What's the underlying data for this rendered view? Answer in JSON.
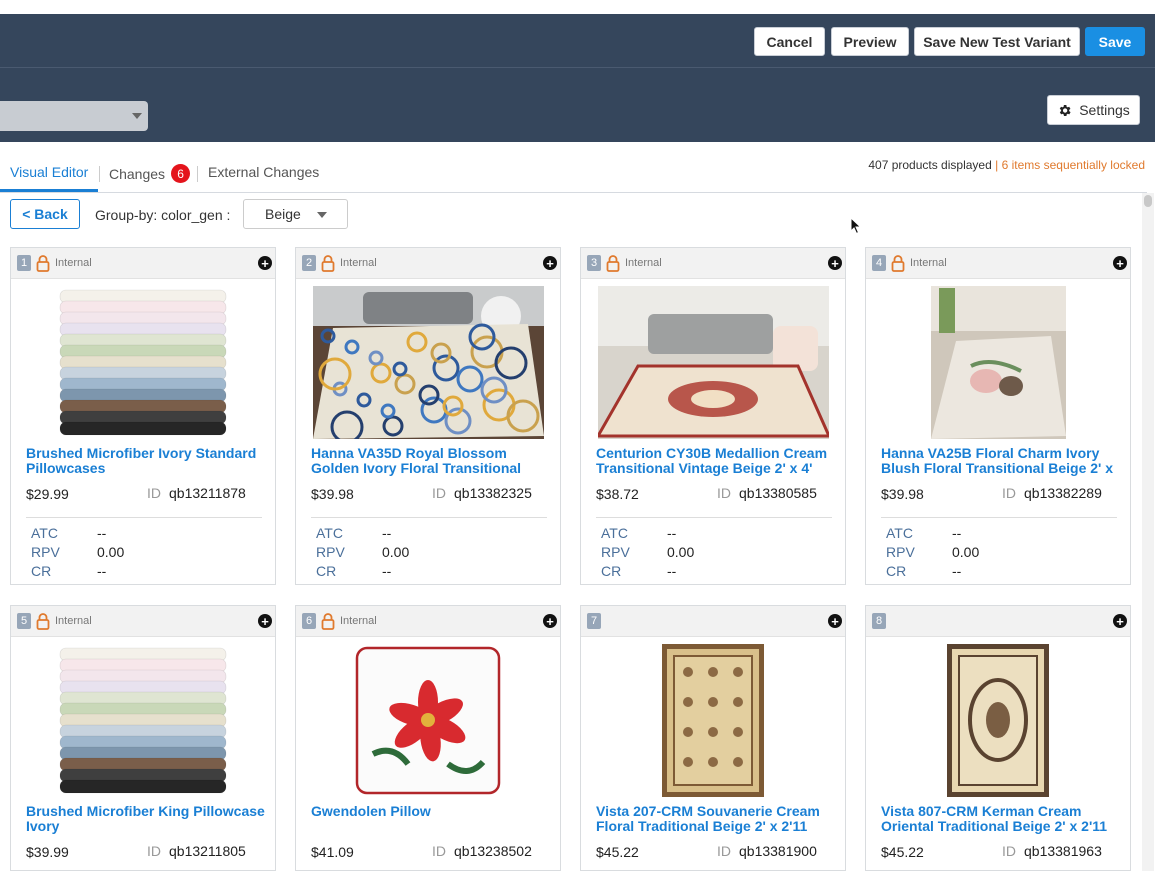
{
  "header": {
    "cancel_label": "Cancel",
    "preview_label": "Preview",
    "save_variant_label": "Save New Test Variant",
    "save_label": "Save",
    "settings_label": "Settings"
  },
  "tabs": {
    "visual_editor": "Visual Editor",
    "changes": "Changes",
    "changes_count": "6",
    "external_changes": "External Changes"
  },
  "status": {
    "products_displayed": "407 products displayed",
    "separator": "|",
    "locked_text": "6 items sequentially locked"
  },
  "toolbar": {
    "back_label": "< Back",
    "groupby_label": "Group-by: color_gen :",
    "groupby_value": "Beige"
  },
  "card_common": {
    "internal_label": "Internal",
    "id_label": "ID",
    "atc_label": "ATC",
    "rpv_label": "RPV",
    "cr_label": "CR"
  },
  "products": [
    {
      "num": "1",
      "locked": true,
      "title": "Brushed Microfiber Ivory Standard Pillowcases",
      "price": "$29.99",
      "id": "qb13211878",
      "atc": "--",
      "rpv": "0.00",
      "cr": "--",
      "image": "stacked-pillowcases"
    },
    {
      "num": "2",
      "locked": true,
      "title": "Hanna VA35D Royal Blossom Golden Ivory Floral Transitional",
      "price": "$39.98",
      "id": "qb13382325",
      "atc": "--",
      "rpv": "0.00",
      "cr": "--",
      "image": "floral-rug-room"
    },
    {
      "num": "3",
      "locked": true,
      "title": "Centurion CY30B Medallion Cream Transitional Vintage Beige 2' x 4'",
      "price": "$38.72",
      "id": "qb13380585",
      "atc": "--",
      "rpv": "0.00",
      "cr": "--",
      "image": "medallion-rug-room"
    },
    {
      "num": "4",
      "locked": true,
      "title": "Hanna VA25B Floral Charm Ivory Blush Floral Transitional Beige 2' x",
      "price": "$39.98",
      "id": "qb13382289",
      "atc": "--",
      "rpv": "0.00",
      "cr": "--",
      "image": "floral-charm-rug"
    },
    {
      "num": "5",
      "locked": true,
      "title": "Brushed Microfiber King Pillowcase Ivory",
      "price": "$39.99",
      "id": "qb13211805",
      "image": "stacked-pillowcases"
    },
    {
      "num": "6",
      "locked": true,
      "title": "Gwendolen Pillow",
      "price": "$41.09",
      "id": "qb13238502",
      "image": "poinsettia-pillow"
    },
    {
      "num": "7",
      "locked": false,
      "title": "Vista 207-CRM Souvanerie Cream Floral Traditional Beige 2' x 2'11",
      "price": "$45.22",
      "id": "qb13381900",
      "image": "traditional-rug"
    },
    {
      "num": "8",
      "locked": false,
      "title": "Vista 807-CRM Kerman Cream Oriental Traditional Beige 2' x 2'11",
      "price": "$45.22",
      "id": "qb13381963",
      "image": "kerman-rug"
    }
  ]
}
